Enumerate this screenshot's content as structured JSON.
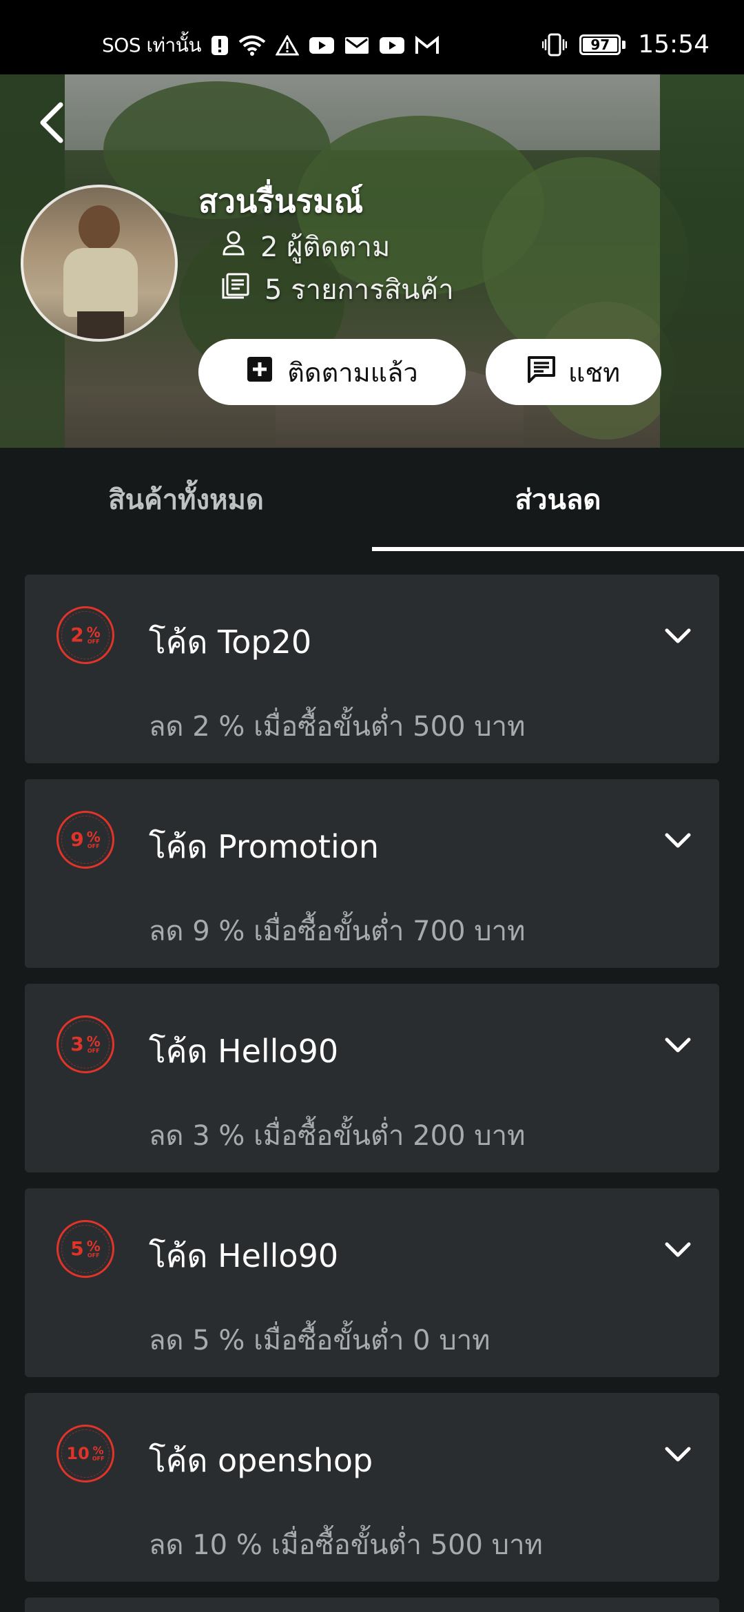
{
  "status_bar": {
    "carrier": "SOS เท่านั้น",
    "battery": "97",
    "time": "15:54"
  },
  "shop": {
    "name": "สวนรื่นรมณ์",
    "followers": "2 ผู้ติดตาม",
    "products": "5 รายการสินค้า",
    "follow_label": "ติดตามแล้ว",
    "chat_label": "แชท"
  },
  "tabs": {
    "all": "สินค้าทั้งหมด",
    "discount": "ส่วนลด",
    "active": "discount"
  },
  "coupons": [
    {
      "badge": "2",
      "code": "โค้ด Top20",
      "desc": "ลด 2 % เมื่อซื้อขั้นต่ำ 500 บาท"
    },
    {
      "badge": "9",
      "code": "โค้ด Promotion",
      "desc": "ลด 9 % เมื่อซื้อขั้นต่ำ 700 บาท"
    },
    {
      "badge": "3",
      "code": "โค้ด Hello90",
      "desc": "ลด 3 % เมื่อซื้อขั้นต่ำ 200 บาท"
    },
    {
      "badge": "5",
      "code": "โค้ด Hello90",
      "desc": "ลด 5 % เมื่อซื้อขั้นต่ำ 0 บาท"
    },
    {
      "badge": "10",
      "code": "โค้ด openshop",
      "desc": "ลด 10 % เมื่อซื้อขั้นต่ำ 500 บาท"
    }
  ],
  "badge_text": {
    "percent": "%",
    "off": "OFF"
  },
  "colors": {
    "background": "#16191a",
    "card": "#2a2d2f",
    "badge_red": "#e0342b",
    "muted_text": "#a8abad"
  },
  "icons": {
    "back": "back-arrow-icon",
    "follow": "plus-box-icon",
    "chat": "chat-icon",
    "followers": "person-icon",
    "products": "list-icon",
    "expand": "chevron-down-icon"
  }
}
